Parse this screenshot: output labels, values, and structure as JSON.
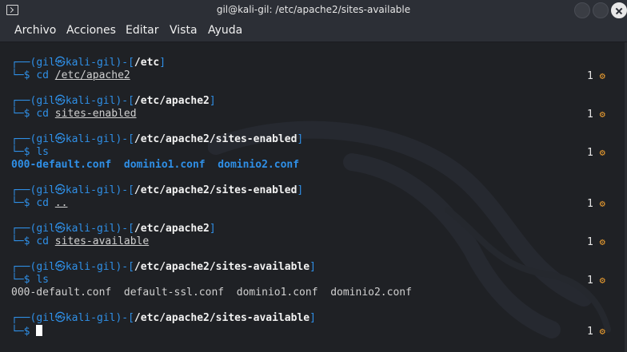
{
  "window": {
    "title": "gil@kali-gil: /etc/apache2/sites-available"
  },
  "menu": {
    "items": [
      "Archivo",
      "Acciones",
      "Editar",
      "Vista",
      "Ayuda"
    ]
  },
  "prompt": {
    "open": "┌──(",
    "user": "gil",
    "at_symbol": "㉿",
    "host": "kali-gil",
    "close_mid": ")-[",
    "close_end": "]",
    "cmd_prefix": "└─",
    "dollar": "$"
  },
  "blocks": [
    {
      "cwd": "/etc",
      "cmd": "cd",
      "arg": "/etc/apache2",
      "status": "1"
    },
    {
      "cwd": "/etc/apache2",
      "cmd": "cd",
      "arg": "sites-enabled",
      "status": "1"
    },
    {
      "cwd": "/etc/apache2/sites-enabled",
      "cmd": "ls",
      "arg": "",
      "status": "1",
      "output": [
        "000-default.conf",
        "dominio1.conf",
        "dominio2.conf"
      ]
    },
    {
      "cwd": "/etc/apache2/sites-enabled",
      "cmd": "cd",
      "arg": "..",
      "status": "1"
    },
    {
      "cwd": "/etc/apache2",
      "cmd": "cd",
      "arg": "sites-available",
      "status": "1"
    },
    {
      "cwd": "/etc/apache2/sites-available",
      "cmd": "ls",
      "arg": "",
      "status": "1",
      "output": [
        "000-default.conf",
        "default-ssl.conf",
        "dominio1.conf",
        "dominio2.conf"
      ]
    },
    {
      "cwd": "/etc/apache2/sites-available",
      "cmd": "",
      "arg": "",
      "status": "1"
    }
  ],
  "status_icon": "gear-icon",
  "colors": {
    "accent_blue": "#2f8fe6",
    "gear_orange": "#f0a030",
    "background": "#1f2125"
  }
}
